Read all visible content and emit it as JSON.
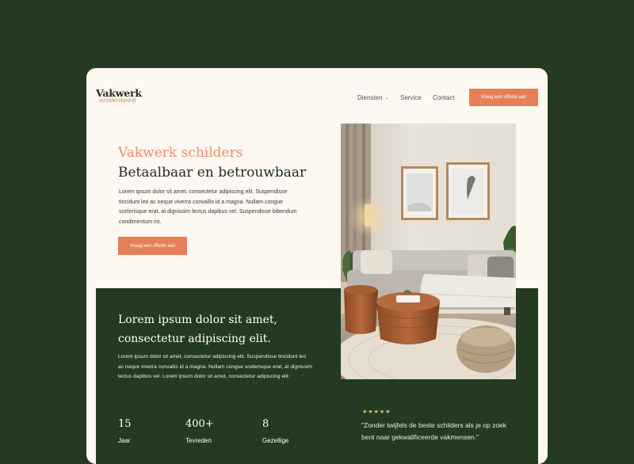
{
  "logo": {
    "name": "Vakwerk",
    "tagline": "schildersbedrijf"
  },
  "nav": {
    "items": [
      "Diensten",
      "Service",
      "Contact"
    ],
    "cta": "Vraag een offerte aan"
  },
  "hero": {
    "subtitle": "Vakwerk schilders",
    "title": "Betaalbaar en betrouwbaar",
    "text": "Lorem ipsum dolor sit amet, consectetur adipiscing elit. Suspendisse tincidunt leo ac neque viverra convallis id a magna. Nullam congue scelerisque erat, at dignissim lectus dapibus vel. Suspendisse bibendum condimentum mi.",
    "cta": "Vraag een offerte aan"
  },
  "about": {
    "title": "Lorem ipsum dolor sit amet, consectetur adipiscing elit.",
    "text": "Lorem ipsum dolor sit amet, consectetur adipiscing elit. Suspendisse tincidunt leo ac neque viverra convallis id a magna. Nullam congue scelerisque erat, at dignissim lectus dapibus vel.  Lorem ipsum dolor sit amet, consectetur adipiscing elit."
  },
  "stats": [
    {
      "number": "15",
      "label": "Jaar"
    },
    {
      "number": "400+",
      "label": "Tevreden"
    },
    {
      "number": "8",
      "label": "Gezellige"
    }
  ],
  "testimonial": {
    "stars": "★★★★★",
    "quote": "\"Zonder twijfels de beste schilders als je op zoek bent naar  gekwalificeerde vakmensen.\""
  },
  "colors": {
    "background": "#243a22",
    "page": "#fdf8f1",
    "accent": "#e67e5a",
    "star": "#e8c15a"
  }
}
